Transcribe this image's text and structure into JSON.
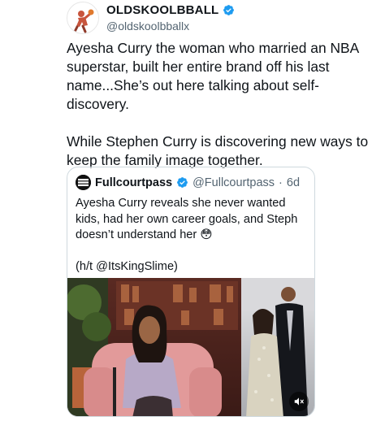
{
  "tweet": {
    "display_name": "OLDSKOOLBBALL",
    "handle": "@oldskoolbballx",
    "paragraphs": [
      "Ayesha Curry the woman who married an NBA superstar, built her entire brand off his last name...She’s out here talking about self-discovery.",
      "While Stephen Curry is discovering new ways to keep the family image together."
    ]
  },
  "quote": {
    "display_name": "Fullcourtpass",
    "handle": "@Fullcourtpass",
    "separator": "·",
    "time": "6d",
    "avatar_text": "FULL COURT PASS",
    "text": "Ayesha Curry reveals she never wanted kids, had her own career goals, and Steph doesn’t understand her 😳",
    "credit": "(h/t @ItsKingSlime)"
  },
  "colors": {
    "verified": "#1d9bf0",
    "text": "#0f1419",
    "secondary": "#536471",
    "border": "#cfd9de"
  },
  "icons": {
    "verified": "verified-badge-icon",
    "mute": "volume-mute-icon"
  }
}
